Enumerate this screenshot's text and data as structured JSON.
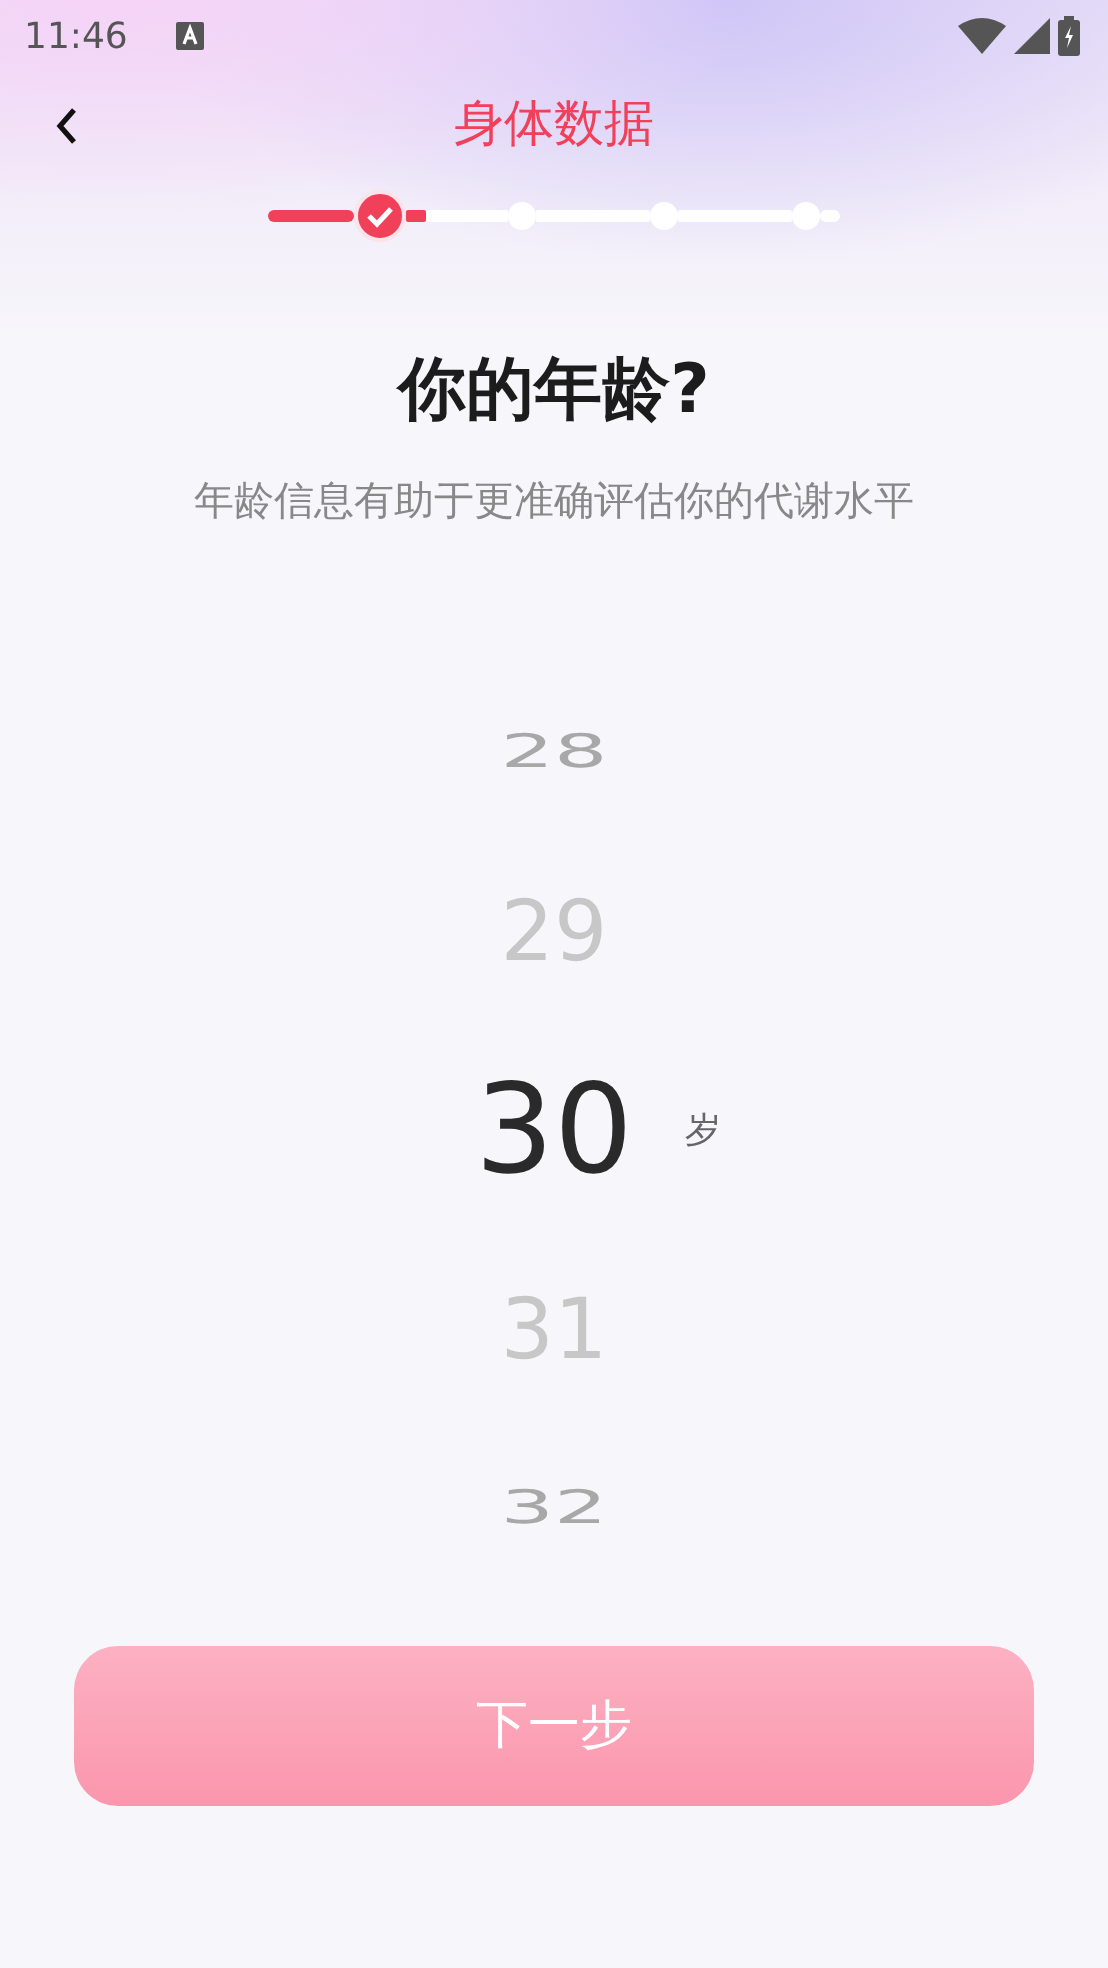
{
  "status_bar": {
    "time": "11:46"
  },
  "header": {
    "title": "身体数据"
  },
  "steps": [
    {
      "selected": true
    },
    {
      "selected": false
    },
    {
      "selected": false
    },
    {
      "selected": false
    }
  ],
  "question": {
    "title": "你的年龄?",
    "subtitle": "年龄信息有助于更准确评估你的代谢水平"
  },
  "picker": {
    "unit": "岁",
    "items": [
      {
        "value": "28",
        "selected": false
      },
      {
        "value": "29",
        "selected": false
      },
      {
        "value": "30",
        "selected": true
      },
      {
        "value": "31",
        "selected": false
      },
      {
        "value": "32",
        "selected": false
      }
    ]
  },
  "next_button": {
    "label": "下一步",
    "disabled": true
  }
}
